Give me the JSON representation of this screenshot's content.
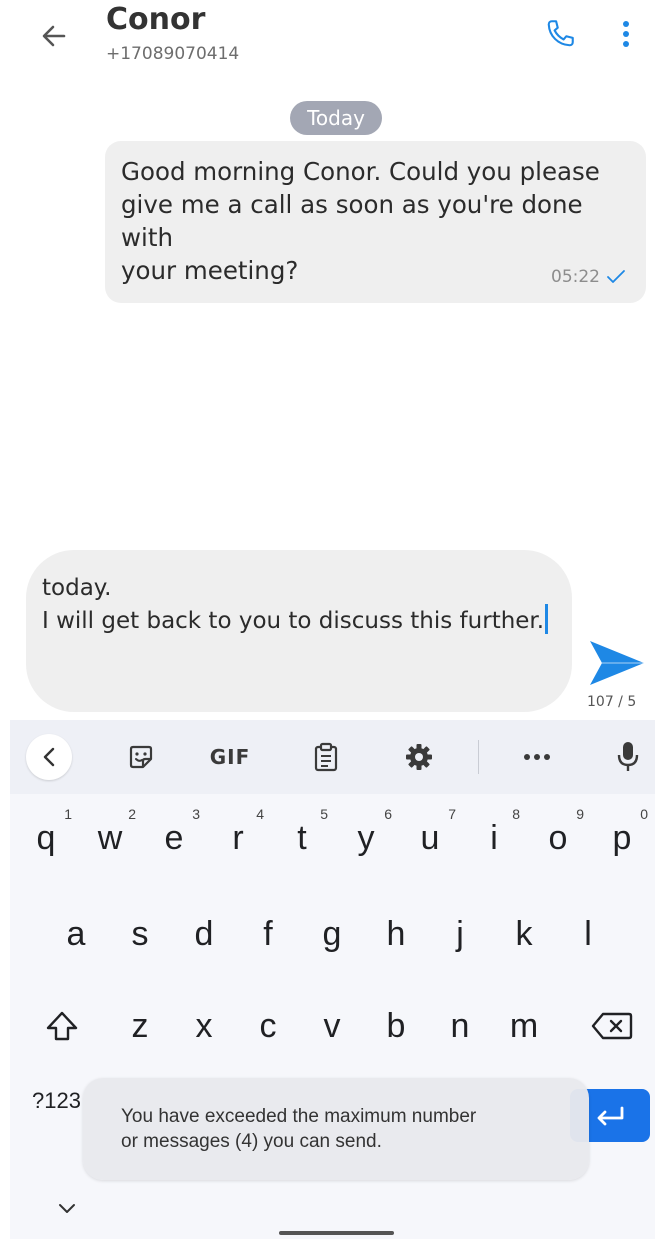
{
  "header": {
    "contact_name": "Conor",
    "contact_phone": "+17089070414",
    "back_icon": "arrow-left-icon",
    "call_icon": "phone-icon",
    "more_icon": "more-vertical-icon"
  },
  "conversation": {
    "date_label": "Today",
    "messages": [
      {
        "text": "Good morning Conor. Could you please\ngive me a call as soon as you're done with\nyour meeting?",
        "time": "05:22",
        "status_icon": "check-icon"
      }
    ]
  },
  "composer": {
    "text": "today.\nI will get back to you to discuss this further.",
    "char_count": "107 / 5",
    "send_icon": "send-icon"
  },
  "keyboard": {
    "toolbar": {
      "collapse_icon": "chevron-left-icon",
      "sticker_icon": "sticker-icon",
      "gif_label": "GIF",
      "clipboard_icon": "clipboard-icon",
      "settings_icon": "gear-icon",
      "more_icon": "more-horizontal-icon",
      "mic_icon": "microphone-icon"
    },
    "row1": [
      {
        "key": "q",
        "hint": "1"
      },
      {
        "key": "w",
        "hint": "2"
      },
      {
        "key": "e",
        "hint": "3"
      },
      {
        "key": "r",
        "hint": "4"
      },
      {
        "key": "t",
        "hint": "5"
      },
      {
        "key": "y",
        "hint": "6"
      },
      {
        "key": "u",
        "hint": "7"
      },
      {
        "key": "i",
        "hint": "8"
      },
      {
        "key": "o",
        "hint": "9"
      },
      {
        "key": "p",
        "hint": "0"
      }
    ],
    "row2": [
      "a",
      "s",
      "d",
      "f",
      "g",
      "h",
      "j",
      "k",
      "l"
    ],
    "row3": [
      "z",
      "x",
      "c",
      "v",
      "b",
      "n",
      "m"
    ],
    "shift_icon": "shift-icon",
    "backspace_icon": "backspace-icon",
    "symbols_label": "?123",
    "enter_icon": "enter-icon",
    "hide_icon": "chevron-down-icon"
  },
  "toast": {
    "message": "You have exceeded the maximum number\nor messages (4) you can send."
  },
  "colors": {
    "accent": "#1e88e5",
    "bubble": "#efefef",
    "date_chip": "#a3a7b4",
    "enter_key": "#1a73e8"
  }
}
